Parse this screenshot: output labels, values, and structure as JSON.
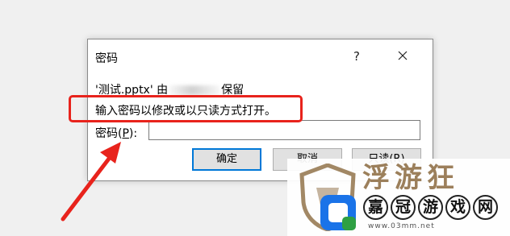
{
  "dialog": {
    "title": "密码",
    "help_label": "?",
    "close_label": "close",
    "message_prefix": "'测试.pptx' 由",
    "message_suffix": "保留",
    "instruction": "输入密码以修改或以只读方式打开。",
    "password_label_text": "密码(",
    "password_label_accel": "P",
    "password_label_end": "):",
    "password_value": "",
    "ok_label": "确定",
    "cancel_label": "取消",
    "readonly_label": "只读(R)"
  },
  "annotation": {
    "highlight_color": "#e8231c",
    "arrow_color": "#e8231c"
  },
  "watermark": {
    "big_text": "浮游狂",
    "brand_chars": [
      "嘉",
      "冠",
      "游",
      "戏",
      "网"
    ],
    "url": "www.03mm.net",
    "accent_color": "#8b6a3f",
    "logo_colors": [
      "#1a73e8",
      "#2ea043"
    ]
  }
}
